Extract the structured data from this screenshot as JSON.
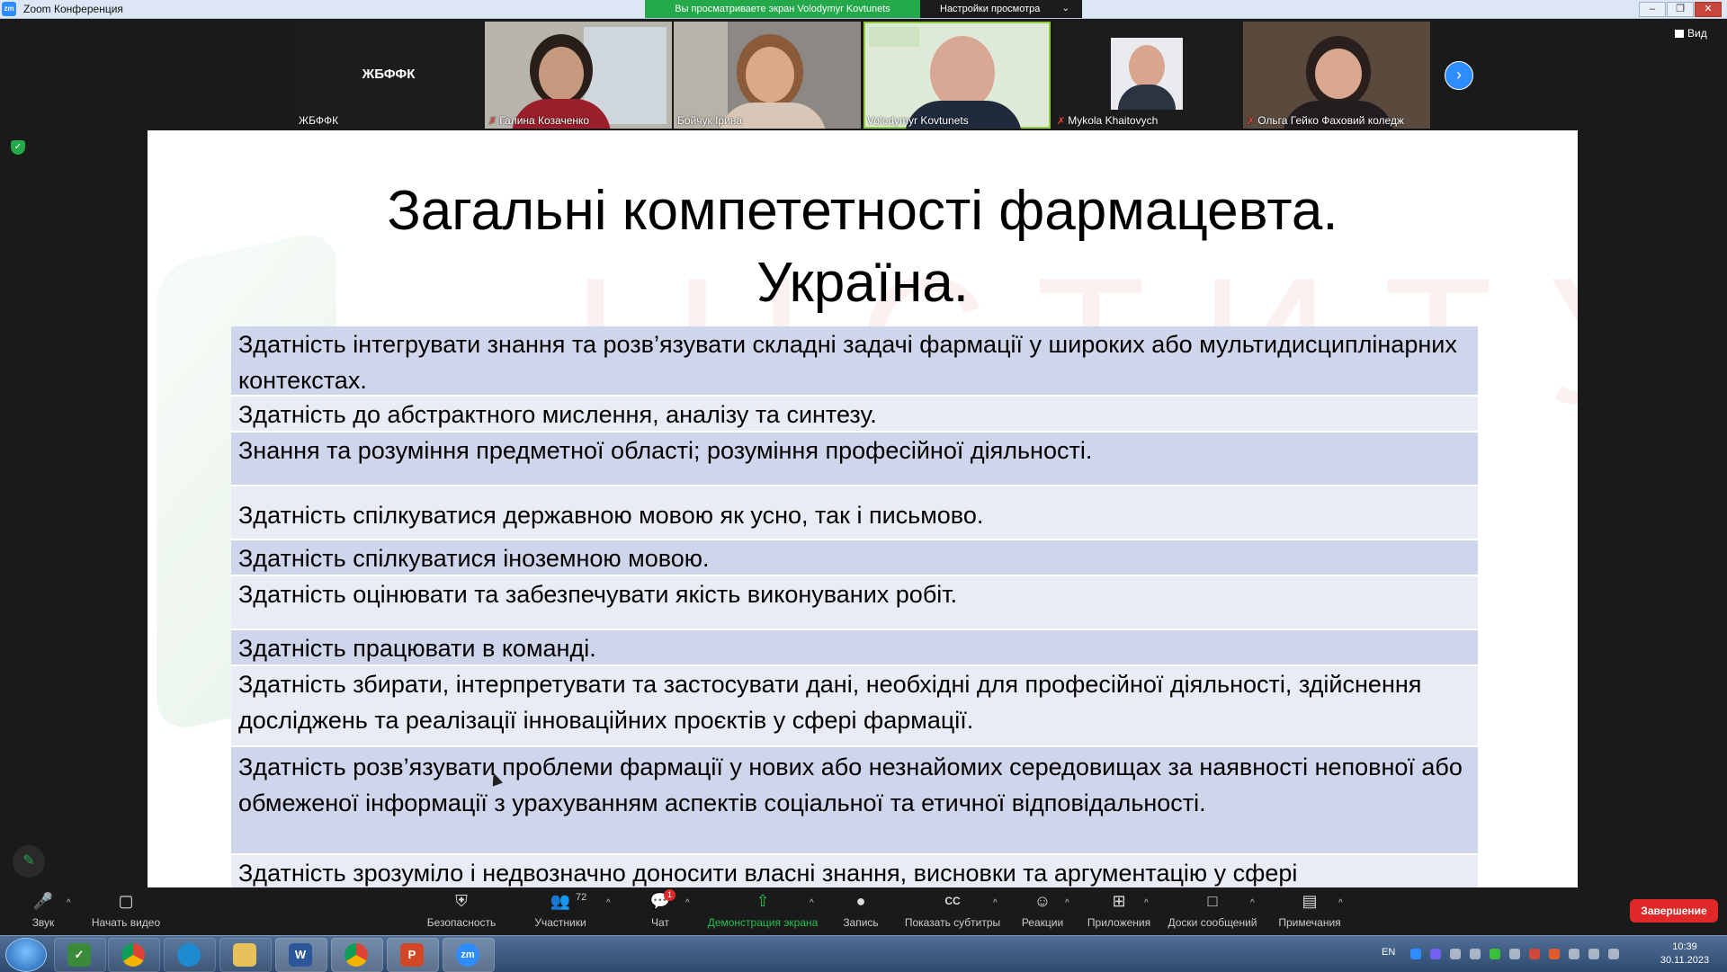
{
  "window": {
    "title": "Zoom Конференция",
    "logo": "zm",
    "share_banner": "Вы просматриваете экран Volodymyr Kovtunets",
    "view_options": "Настройки просмотра",
    "controls": [
      "–",
      "❐",
      "✕"
    ]
  },
  "gallery": {
    "view_button": "Вид",
    "tiles": [
      {
        "name": "ЖБФФК",
        "center_name": "ЖБФФК",
        "muted": false
      },
      {
        "name": "Галина Козаченко",
        "muted": true
      },
      {
        "name": "Бойчук Ірина",
        "muted": false
      },
      {
        "name": "Volodymyr Kovtunets",
        "muted": false,
        "active": true
      },
      {
        "name": "Mykola Khaitovych",
        "muted": true
      },
      {
        "name": "Ольга Гейко Фаховий коледж",
        "muted": true
      }
    ]
  },
  "slide": {
    "title_line1": "Загальні компететності фармацевта.",
    "title_line2": "Україна.",
    "watermark": "ІНСТИТУ",
    "rows": [
      "Здатність інтегрувати знання та розв’язувати складні задачі фармації у широких або мультидисциплінарних контекстах.",
      "Здатність до абстрактного мислення, аналізу та синтезу.",
      "Знання та розуміння предметної області; розуміння професійної діяльності.",
      "Здатність спілкуватися державною мовою як усно, так і письмово.",
      "Здатність спілкуватися іноземною мовою.",
      "Здатність оцінювати та забезпечувати якість виконуваних робіт.",
      "Здатність працювати в команді.",
      "Здатність збирати, інтерпретувати та застосувати дані, необхідні для професійної діяльності, здійснення досліджень та реалізації інноваційних проєктів у сфері фармації.",
      "Здатність розв’язувати проблеми фармації у нових або незнайомих середовищах за наявності неповної або обмеженої інформації з урахуванням аспектів соціальної та етичної відповідальності.",
      "Здатність зрозуміло і недвозначно доносити власні знання, висновки та аргументацію у сфері"
    ]
  },
  "toolbar": {
    "audio": "Звук",
    "video": "Начать видео",
    "security": "Безопасность",
    "participants": "Участники",
    "participants_count": "72",
    "chat": "Чат",
    "chat_badge": "1",
    "share": "Демонстрация экрана",
    "record": "Запись",
    "captions": "Показать субтитры",
    "captions_icon": "CC",
    "reactions": "Реакции",
    "apps": "Приложения",
    "whiteboards": "Доски сообщений",
    "notes": "Примечания",
    "end": "Завершение"
  },
  "taskbar": {
    "zoom_label": "zm",
    "lang": "EN",
    "time": "10:39",
    "date": "30.11.2023"
  },
  "colors": {
    "share_green": "#23a94a",
    "zoom_blue": "#2d8cff",
    "end_red": "#e02828",
    "row_dark": "#cfd5ea",
    "row_light": "#e9ebf5"
  }
}
